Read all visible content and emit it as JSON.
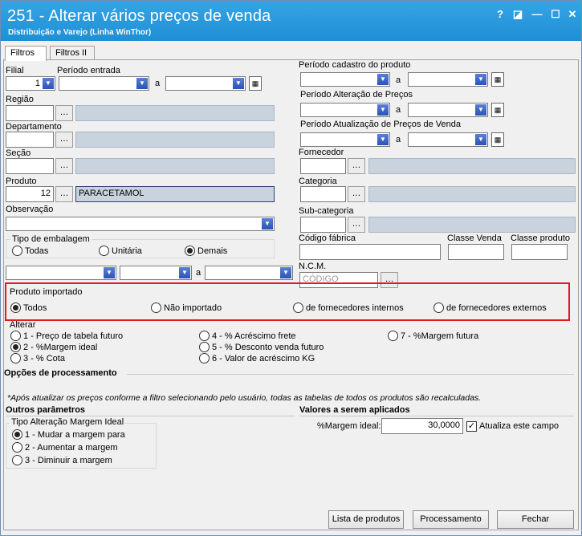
{
  "window": {
    "title": "251 - Alterar vários preços de venda",
    "subtitle": "Distribuição e Varejo (Linha WinThor)",
    "controls": [
      "?",
      "restore",
      "minimize",
      "maximize",
      "close"
    ]
  },
  "tabs": [
    {
      "label": "Filtros",
      "active": true
    },
    {
      "label": "Filtros II",
      "active": false
    }
  ],
  "left": {
    "filial_label": "Filial",
    "filial_value": "1",
    "periodo_entrada_label": "Período entrada",
    "a_label": "a",
    "regiao_label": "Região",
    "departamento_label": "Departamento",
    "secao_label": "Seção",
    "produto_label": "Produto",
    "produto_code": "12",
    "produto_desc": "PARACETAMOL",
    "observacao_label": "Observação",
    "tipo_embalagem_label": "Tipo de embalagem",
    "embalagem_options": [
      {
        "label": "Todas",
        "selected": false
      },
      {
        "label": "Unitária",
        "selected": false
      },
      {
        "label": "Demais",
        "selected": true
      }
    ],
    "range_a_label": "a"
  },
  "right": {
    "periodo_cadastro_label": "Período cadastro do produto",
    "periodo_alteracao_label": "Período Alteração de Preços",
    "periodo_atualizacao_label": "Período Atualização de Preços de Venda",
    "a_label": "a",
    "fornecedor_label": "Fornecedor",
    "categoria_label": "Categoria",
    "subcategoria_label": "Sub-categoria",
    "codigo_fabrica_label": "Código fábrica",
    "classe_venda_label": "Classe Venda",
    "classe_produto_label": "Classe produto",
    "ncm_label": "N.C.M.",
    "ncm_placeholder": "CÓDIGO"
  },
  "produto_importado": {
    "label": "Produto importado",
    "options": [
      {
        "label": "Todos",
        "selected": true
      },
      {
        "label": "Não importado",
        "selected": false
      },
      {
        "label": "de fornecedores internos",
        "selected": false
      },
      {
        "label": "de fornecedores externos",
        "selected": false
      }
    ]
  },
  "alterar": {
    "label": "Alterar",
    "options": [
      {
        "label": "1 - Preço de tabela futuro",
        "selected": false
      },
      {
        "label": "2 - %Margem ideal",
        "selected": true
      },
      {
        "label": "3 - % Cota",
        "selected": false
      },
      {
        "label": "4 - % Acréscimo frete",
        "selected": false
      },
      {
        "label": "5 - % Desconto venda futuro",
        "selected": false
      },
      {
        "label": "6 - Valor de acréscimo KG",
        "selected": false
      },
      {
        "label": "7 - %Margem futura",
        "selected": false
      }
    ]
  },
  "processamento": {
    "title": "Opções de processamento",
    "note": "*Após atualizar os preços conforme a filtro selecionando pelo usuário, todas as tabelas de todos os produtos são recalculadas."
  },
  "outros": {
    "title": "Outros parâmetros",
    "tipo_label": "Tipo Alteração Margem Ideal",
    "options": [
      {
        "label": "1 - Mudar a margem para",
        "selected": true
      },
      {
        "label": "2 - Aumentar a margem",
        "selected": false
      },
      {
        "label": "3 - Diminuir a margem",
        "selected": false
      }
    ]
  },
  "valores": {
    "title": "Valores a serem aplicados",
    "margem_label": "%Margem ideal:",
    "margem_value": "30,0000",
    "atualiza_label": "Atualiza este campo",
    "atualiza_checked": true
  },
  "buttons": {
    "lista": "Lista de produtos",
    "processamento": "Processamento",
    "fechar": "Fechar"
  },
  "colors": {
    "titlebar": "#1f8fd5",
    "highlight_border": "#e01b1b",
    "readonly_field": "#c8d3de"
  }
}
